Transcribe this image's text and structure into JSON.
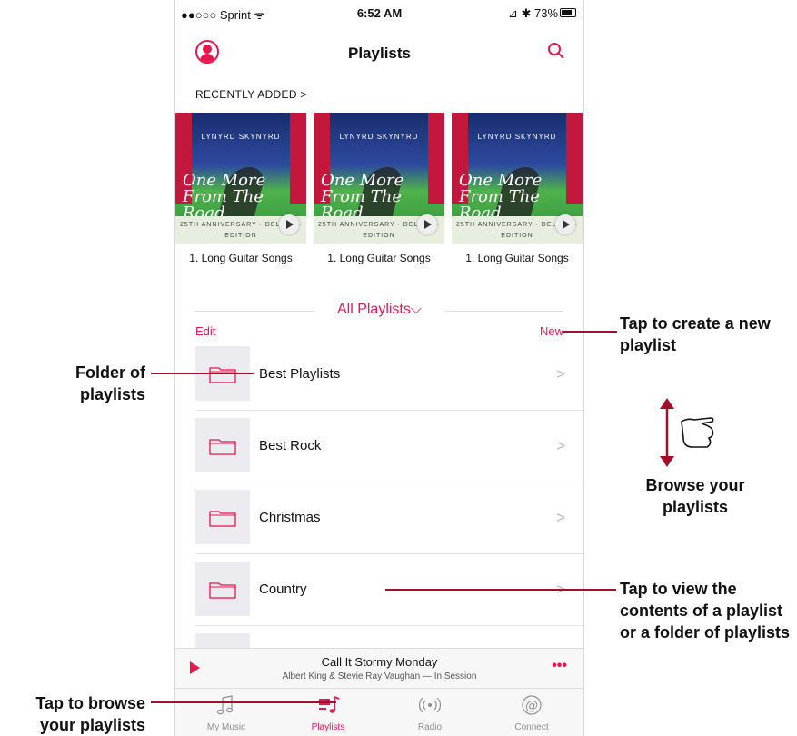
{
  "status_bar": {
    "carrier": "●●○○○ Sprint ᯤ",
    "time": "6:52 AM",
    "right": "⊿ ✱ 73%",
    "battery_level": 0.73
  },
  "nav": {
    "title": "Playlists"
  },
  "recently_added": {
    "label": "RECENTLY ADDED >",
    "items": [
      {
        "title": "1. Long Guitar Songs",
        "art_band": "LYNYRD SKYNYRD",
        "art_script": "One More From The Road",
        "art_caption": "25TH ANNIVERSARY · DELUXE · EDITION"
      },
      {
        "title": "1. Long Guitar Songs",
        "art_band": "LYNYRD SKYNYRD",
        "art_script": "One More From The Road",
        "art_caption": "25TH ANNIVERSARY · DELUXE · EDITION"
      },
      {
        "title": "1. Long Guitar Songs",
        "art_band": "LYNYRD SKYNYRD",
        "art_script": "One More From The Road",
        "art_caption": "25TH ANNIVERSARY · DELUXE · EDITION"
      }
    ]
  },
  "all_playlists": {
    "title": "All Playlists⌵",
    "edit": "Edit",
    "new": "New"
  },
  "playlists": [
    {
      "label": "Best Playlists"
    },
    {
      "label": "Best Rock"
    },
    {
      "label": "Christmas"
    },
    {
      "label": "Country"
    },
    {
      "label": ""
    }
  ],
  "now_playing": {
    "song": "Call It Stormy Monday",
    "artist": "Albert King & Stevie Ray Vaughan — In Session",
    "more": "•••"
  },
  "tabs": [
    {
      "label": "My Music",
      "icon": "music-note-icon",
      "active": false
    },
    {
      "label": "Playlists",
      "icon": "playlist-icon",
      "active": true
    },
    {
      "label": "Radio",
      "icon": "radio-icon",
      "active": false
    },
    {
      "label": "Connect",
      "icon": "connect-icon",
      "active": false
    }
  ],
  "callouts": {
    "create": "Tap to create a new playlist",
    "folder": "Folder of playlists",
    "browse": "Browse your playlists",
    "view": "Tap to view the contents of a playlist or a folder of playlists",
    "browse_tab": "Tap to browse your playlists"
  },
  "colors": {
    "accent": "#e5174f",
    "callout_line": "#a0102c"
  }
}
